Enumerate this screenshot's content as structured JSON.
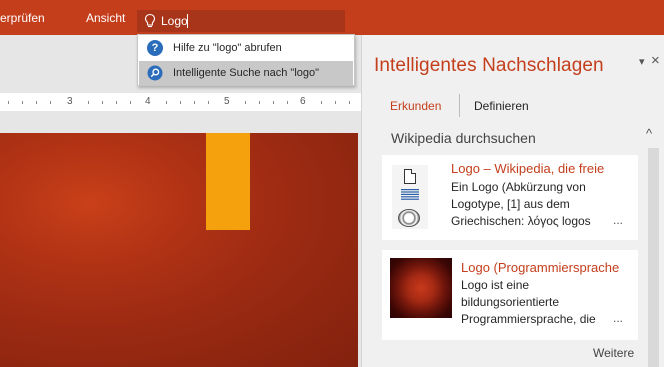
{
  "ribbon": {
    "tabs": [
      {
        "label": "erprüfen"
      },
      {
        "label": "Ansicht"
      }
    ],
    "search": {
      "icon": "lightbulb-icon",
      "value": "Logo"
    }
  },
  "dropdown": {
    "items": [
      {
        "label": "Hilfe zu \"logo\" abrufen",
        "icon": "help-icon"
      },
      {
        "label": "Intelligente Suche nach \"logo\"",
        "icon": "smart-lookup-icon"
      }
    ]
  },
  "ruler": {
    "marks": [
      "3",
      "4",
      "5",
      "6"
    ]
  },
  "pane": {
    "title": "Intelligentes Nachschlagen",
    "tabs": [
      {
        "label": "Erkunden",
        "active": true
      },
      {
        "label": "Definieren",
        "active": false
      }
    ],
    "section_title": "Wikipedia durchsuchen",
    "results": [
      {
        "title": "Logo – Wikipedia, die freie",
        "lines": [
          "Ein Logo (Abkürzung von",
          "Logotype, [1] aus dem",
          "Griechischen: λόγος logos"
        ],
        "ellipsis": "..."
      },
      {
        "title": "Logo (Programmiersprache",
        "lines": [
          "Logo ist eine",
          "bildungsorientierte",
          "Programmiersprache, die"
        ],
        "ellipsis": "..."
      }
    ],
    "more_label": "Weitere"
  },
  "colors": {
    "accent": "#c43e1c",
    "ribbon": "#c43e1c",
    "slide": "#9b2a12",
    "orange_shape": "#f5a10d"
  }
}
